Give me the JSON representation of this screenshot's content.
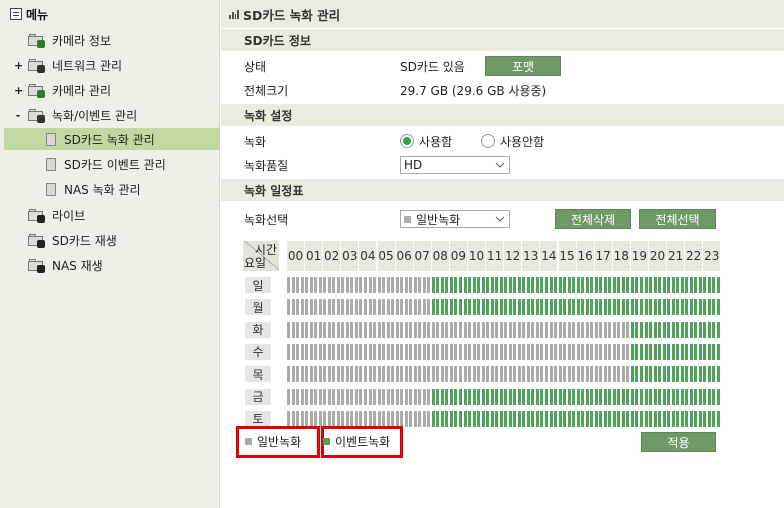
{
  "sidebar": {
    "header": "메뉴",
    "items": [
      {
        "label": "카메라 정보",
        "toggle": "",
        "badge": "#2a7d2a"
      },
      {
        "label": "네트워크 관리",
        "toggle": "+",
        "badge": "#333333"
      },
      {
        "label": "카메라 관리",
        "toggle": "+",
        "badge": "#2a7d2a"
      },
      {
        "label": "녹화/이벤트 관리",
        "toggle": "-",
        "badge": "#333333"
      },
      {
        "label": "SD카드 녹화 관리",
        "sub": true,
        "selected": true
      },
      {
        "label": "SD카드 이벤트 관리",
        "sub": true
      },
      {
        "label": "NAS 녹화 관리",
        "sub": true
      },
      {
        "label": "라이브",
        "toggle": "",
        "badge": "#222222"
      },
      {
        "label": "SD카드 재생",
        "toggle": "",
        "badge": "#222222"
      },
      {
        "label": "NAS 재생",
        "toggle": "",
        "badge": "#222222"
      }
    ]
  },
  "main": {
    "title": "SD카드 녹화 관리",
    "sd_info": {
      "header": "SD카드 정보",
      "status_label": "상태",
      "status_value": "SD카드 있음",
      "format_button": "포맷",
      "total_label": "전체크기",
      "total_value": "29.7 GB (29.6 GB 사용중)"
    },
    "rec_settings": {
      "header": "녹화 설정",
      "rec_label": "녹화",
      "use_option": "사용함",
      "nouse_option": "사용안함",
      "use_selected": true,
      "quality_label": "녹화품질",
      "quality_value": "HD"
    },
    "schedule": {
      "header": "녹화 일정표",
      "select_label": "녹화선택",
      "select_value": "일반녹화",
      "clear_all_button": "전체삭제",
      "select_all_button": "전체선택",
      "corner_time": "시간",
      "corner_day": "요일",
      "hours": [
        "00",
        "01",
        "02",
        "03",
        "04",
        "05",
        "06",
        "07",
        "08",
        "09",
        "10",
        "11",
        "12",
        "13",
        "14",
        "15",
        "16",
        "17",
        "18",
        "19",
        "20",
        "21",
        "22",
        "23"
      ],
      "days": [
        {
          "label": "일",
          "event_from_hour": 8
        },
        {
          "label": "월",
          "event_from_hour": 8
        },
        {
          "label": "화",
          "event_from_hour": 19
        },
        {
          "label": "수",
          "event_from_hour": 19
        },
        {
          "label": "목",
          "event_from_hour": 19
        },
        {
          "label": "금",
          "event_from_hour": 8
        },
        {
          "label": "토",
          "event_from_hour": 8
        }
      ],
      "legend_general": "일반녹화",
      "legend_event": "이벤트녹화",
      "apply_button": "적용"
    }
  },
  "colors": {
    "accent_green": "#6f9a68",
    "event_slot": "#4ea259",
    "general_slot": "#ababab",
    "highlight_red": "#e00000",
    "selected_menu": "#c3d8a0"
  }
}
